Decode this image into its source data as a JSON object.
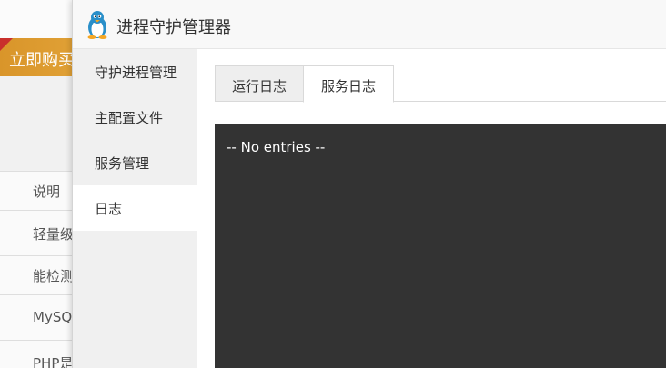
{
  "background": {
    "buy_button_label": "立即购买",
    "rows": [
      "说明",
      "轻量级",
      "能检测",
      "MySQL",
      "PHP是"
    ]
  },
  "dialog": {
    "title": "进程守护管理器",
    "logo_icon": "linux-penguin-icon",
    "sidebar": {
      "items": [
        {
          "label": "守护进程管理",
          "active": false
        },
        {
          "label": "主配置文件",
          "active": false
        },
        {
          "label": "服务管理",
          "active": false
        },
        {
          "label": "日志",
          "active": true
        }
      ]
    },
    "tabs": [
      {
        "label": "运行日志",
        "active": false
      },
      {
        "label": "服务日志",
        "active": true
      }
    ],
    "log": {
      "text": "-- No entries --"
    }
  },
  "colors": {
    "log_background": "#333333",
    "sidebar_background": "#f0f0f0",
    "buy_button": "#e0a035"
  }
}
